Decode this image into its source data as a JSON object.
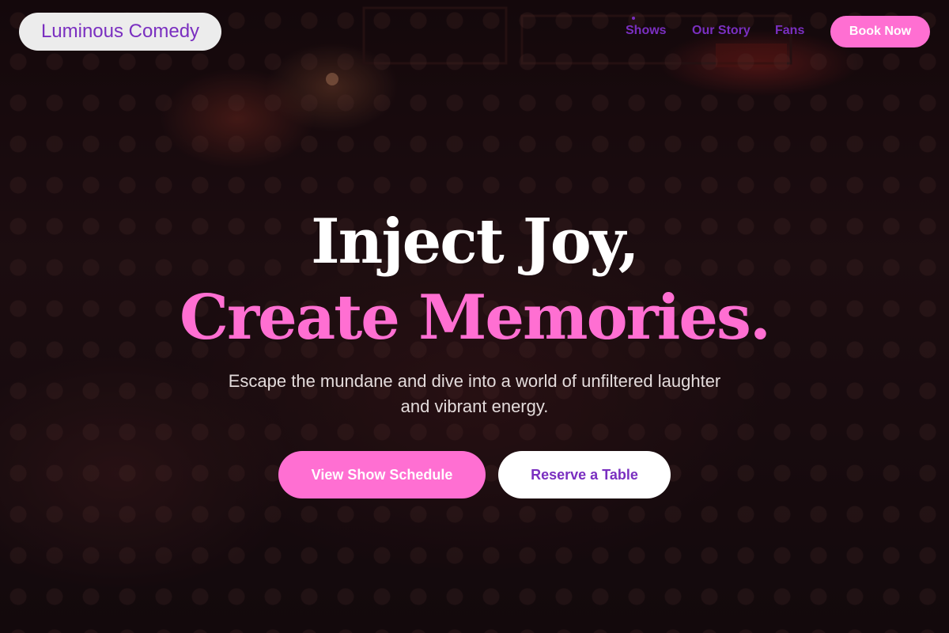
{
  "nav": {
    "brand": "Luminous Comedy",
    "links": [
      "Shows",
      "Our Story",
      "Fans"
    ],
    "cta": "Book Now"
  },
  "hero": {
    "headline_line1": "Inject Joy,",
    "headline_line2": "Create Memories.",
    "subtext": "Escape the mundane and dive into a world of unfiltered laughter and vibrant energy.",
    "primary_cta": "View Show Schedule",
    "secondary_cta": "Reserve a Table",
    "background": "concert-crowd-photo"
  },
  "colors": {
    "accent_pink": "#ff6fd2",
    "brand_purple": "#7a2fc0",
    "text_white": "#ffffff"
  }
}
